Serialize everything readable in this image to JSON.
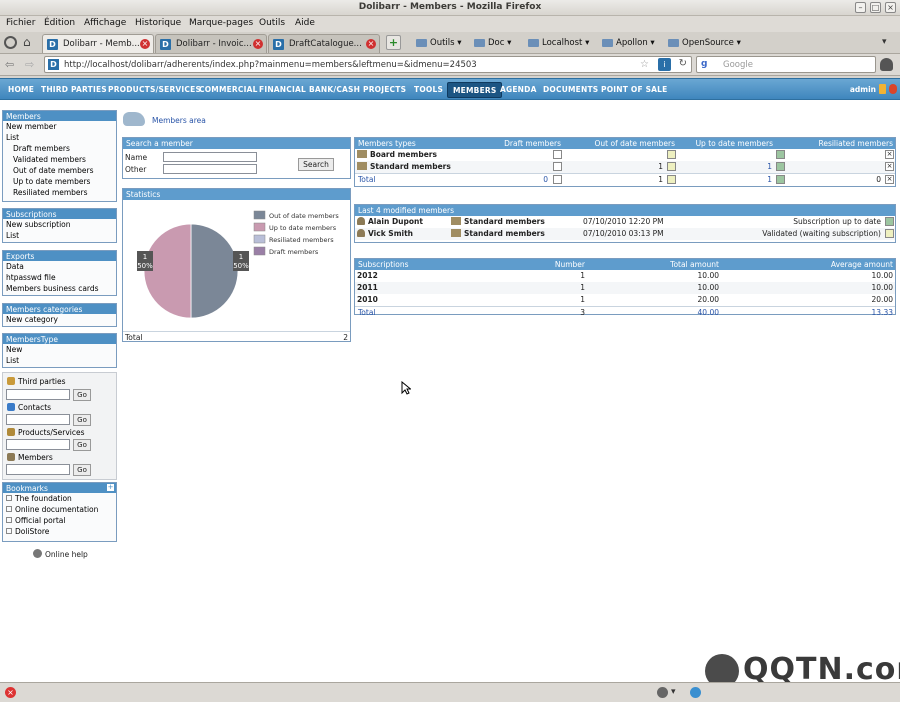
{
  "window": {
    "title": "Dolibarr - Members - Mozilla Firefox"
  },
  "menubar": [
    "Fichier",
    "Édition",
    "Affichage",
    "Historique",
    "Marque-pages",
    "Outils",
    "Aide"
  ],
  "tabs": [
    {
      "label": "Dolibarr - Memb..."
    },
    {
      "label": "Dolibarr - Invoic..."
    },
    {
      "label": "DraftCatalogue..."
    }
  ],
  "bookmarks": [
    "Outils",
    "Doc",
    "Localhost",
    "Apollon",
    "OpenSource"
  ],
  "nav": {
    "url": "http://localhost/dolibarr/adherents/index.php?mainmenu=members&leftmenu=&idmenu=24503",
    "search_placeholder": "Google"
  },
  "topmenu": [
    "HOME",
    "THIRD PARTIES",
    "PRODUCTS/SERVICES",
    "COMMERCIAL",
    "FINANCIAL",
    "BANK/CASH",
    "PROJECTS",
    "TOOLS",
    "MEMBERS",
    "AGENDA",
    "DOCUMENTS",
    "POINT OF SALE"
  ],
  "topmenu_active": "MEMBERS",
  "user": "admin",
  "leftmenu": {
    "members": {
      "title": "Members",
      "items": [
        "New member",
        "List"
      ],
      "subitems": [
        "Draft members",
        "Validated members",
        "Out of date members",
        "Up to date members",
        "Resiliated members"
      ]
    },
    "subscriptions": {
      "title": "Subscriptions",
      "items": [
        "New subscription",
        "List"
      ]
    },
    "exports": {
      "title": "Exports",
      "items": [
        "Data",
        "htpasswd file",
        "Members business cards"
      ]
    },
    "categories": {
      "title": "Members categories",
      "items": [
        "New category"
      ]
    },
    "types": {
      "title": "MembersType",
      "items": [
        "New",
        "List"
      ]
    }
  },
  "quicksearch": {
    "labels": [
      "Third parties",
      "Contacts",
      "Products/Services",
      "Members"
    ],
    "go": "Go"
  },
  "bookmarks_panel": {
    "title": "Bookmarks",
    "items": [
      "The foundation",
      "Online documentation",
      "Official portal",
      "DoliStore"
    ]
  },
  "online_help": "Online help",
  "page": {
    "title": "Members area"
  },
  "search": {
    "title": "Search a member",
    "name_label": "Name",
    "other_label": "Other",
    "button": "Search"
  },
  "statistics": {
    "title": "Statistics",
    "total_label": "Total",
    "total_value": "2"
  },
  "chart_data": {
    "type": "pie",
    "legend": [
      "Out of date members",
      "Up to date members",
      "Resiliated members",
      "Draft members"
    ],
    "colors": [
      "#7b8797",
      "#c99ab0",
      "#b9bfd8",
      "#9a7fa6"
    ],
    "values": [
      1,
      1,
      0,
      0
    ],
    "slice_labels": [
      {
        "count": "1",
        "pct": "50%"
      },
      {
        "count": "1",
        "pct": "50%"
      }
    ]
  },
  "types_table": {
    "headers": [
      "Members types",
      "Draft members",
      "Out of date members",
      "Up to date members",
      "Resiliated members"
    ],
    "rows": [
      {
        "name": "Board members",
        "draft": "",
        "outofdate": "",
        "uptodate": "",
        "resiliated": ""
      },
      {
        "name": "Standard members",
        "draft": "",
        "outofdate": "1",
        "uptodate": "1",
        "resiliated": ""
      }
    ],
    "total": {
      "name": "Total",
      "draft": "0",
      "outofdate": "1",
      "uptodate": "1",
      "resiliated": "0"
    }
  },
  "last_modified": {
    "title": "Last 4 modified members",
    "rows": [
      {
        "name": "Alain Dupont",
        "type": "Standard members",
        "date": "07/10/2010 12:20 PM",
        "status": "Subscription up to date"
      },
      {
        "name": "Vick Smith",
        "type": "Standard members",
        "date": "07/10/2010 03:13 PM",
        "status": "Validated (waiting subscription)"
      }
    ]
  },
  "subscriptions_table": {
    "headers": [
      "Subscriptions",
      "Number",
      "Total amount",
      "Average amount"
    ],
    "rows": [
      {
        "year": "2012",
        "number": "1",
        "total": "10.00",
        "avg": "10.00"
      },
      {
        "year": "2011",
        "number": "1",
        "total": "10.00",
        "avg": "10.00"
      },
      {
        "year": "2010",
        "number": "1",
        "total": "20.00",
        "avg": "20.00"
      }
    ],
    "total": {
      "year": "Total",
      "number": "3",
      "total": "40.00",
      "avg": "13.33"
    }
  },
  "watermark": "QQTN.com"
}
